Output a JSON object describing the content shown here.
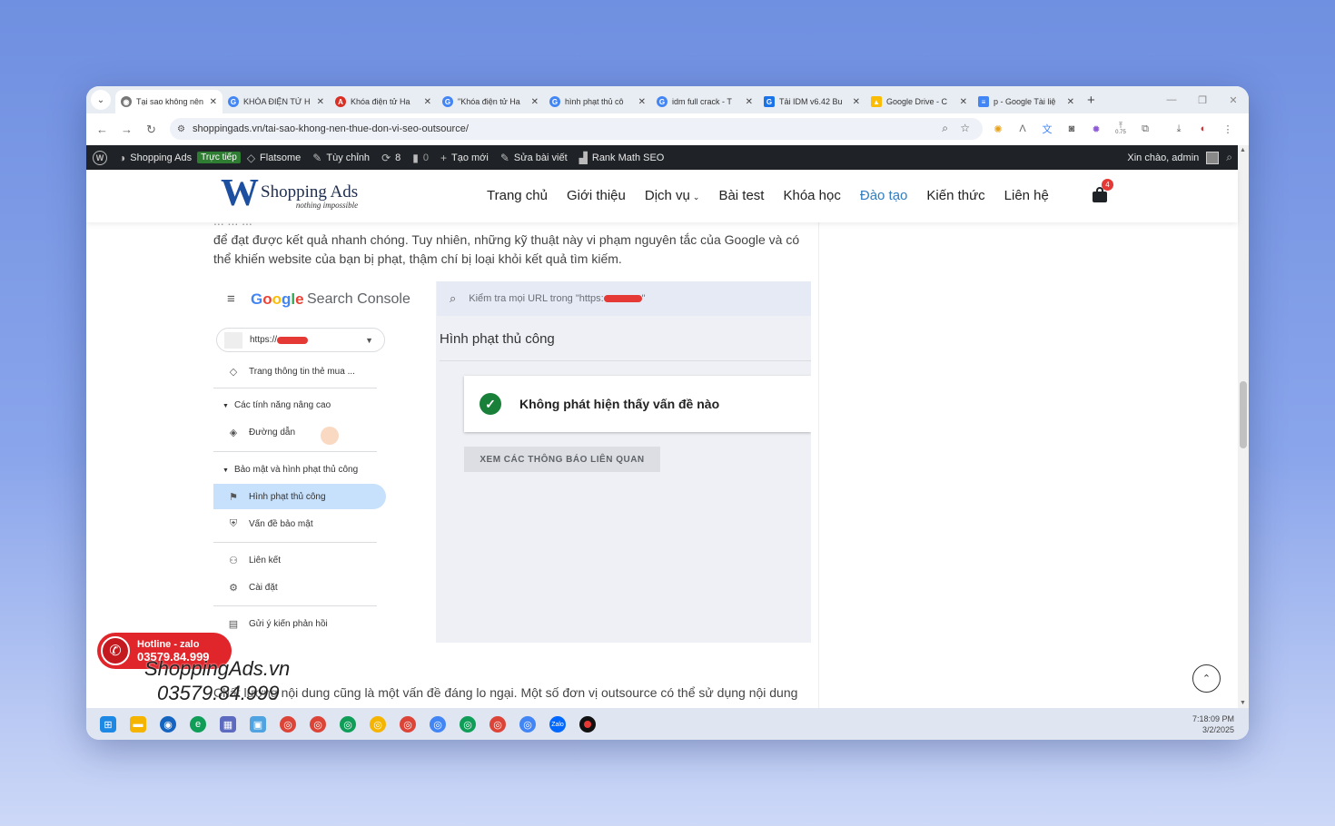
{
  "browser": {
    "tabs": [
      {
        "title": "Tại sao không nên",
        "active": true
      },
      {
        "title": "KHÓA ĐIỆN TỬ H"
      },
      {
        "title": "Khóa điện tử Ha"
      },
      {
        "title": "\"Khóa điện tử Ha"
      },
      {
        "title": "hình phạt thủ cô"
      },
      {
        "title": "idm full crack - T"
      },
      {
        "title": "Tải IDM v6.42 Bu"
      },
      {
        "title": "Google Drive - C"
      },
      {
        "title": "p - Google Tài liệ"
      }
    ],
    "url": "shoppingads.vn/tai-sao-khong-nen-thue-don-vi-seo-outsource/",
    "ext_badge": "0.75"
  },
  "wpbar": {
    "site": "Shopping Ads",
    "live": "Trực tiếp",
    "theme": "Flatsome",
    "customize": "Tùy chỉnh",
    "updates": "8",
    "comments": "0",
    "new": "Tạo mới",
    "edit": "Sửa bài viết",
    "rankmath": "Rank Math SEO",
    "greeting": "Xin chào, admin"
  },
  "site": {
    "logo_name": "Shopping Ads",
    "logo_tagline": "nothing impossible",
    "nav": [
      "Trang chủ",
      "Giới thiệu",
      "Dịch vụ",
      "Bài test",
      "Khóa học",
      "Đào tạo",
      "Kiến thức",
      "Liên hệ"
    ],
    "active_nav": "Đào tạo",
    "cart_count": "4"
  },
  "article": {
    "para1_line0": "... ... ...",
    "para1": "để đạt được kết quả nhanh chóng. Tuy nhiên, những kỹ thuật này vi phạm nguyên tắc của Google và có thể khiến website của bạn bị phạt, thậm chí bị loại khỏi kết quả tìm kiếm.",
    "para2": "Chất lượng nội dung cũng là một vấn đề đáng lo ngại. Một số đơn vị outsource có thể sử dụng nội dung"
  },
  "gsc": {
    "product": "Search Console",
    "search_placeholder": "Kiểm tra mọi URL trong \"https:",
    "property": "https://",
    "sidebar": {
      "shopping": "Trang thông tin thẻ mua ...",
      "advanced_header": "Các tính năng nâng cao",
      "breadcrumbs": "Đường dẫn",
      "security_header": "Bảo mật và hình phạt thủ công",
      "manual_actions": "Hình phạt thủ công",
      "security_issues": "Vấn đề bảo mật",
      "links": "Liên kết",
      "settings": "Cài đặt",
      "feedback": "Gửi ý kiến phản hồi"
    },
    "page_title": "Hình phạt thủ công",
    "status": "Không phát hiện thấy vấn đề nào",
    "button": "XEM CÁC THÔNG BÁO LIÊN QUAN"
  },
  "floating": {
    "hotline_label": "Hotline - zalo",
    "hotline_number": "03579.84.999",
    "watermark_site": "ShoppingAds.vn",
    "watermark_phone": "03579.84.999"
  },
  "taskbar": {
    "time": "7:18:09 PM",
    "date": "3/2/2025"
  },
  "colors": {
    "accent_nav": "#2f7dc2",
    "hotline_red": "#e0262b",
    "check_green": "#188038"
  }
}
